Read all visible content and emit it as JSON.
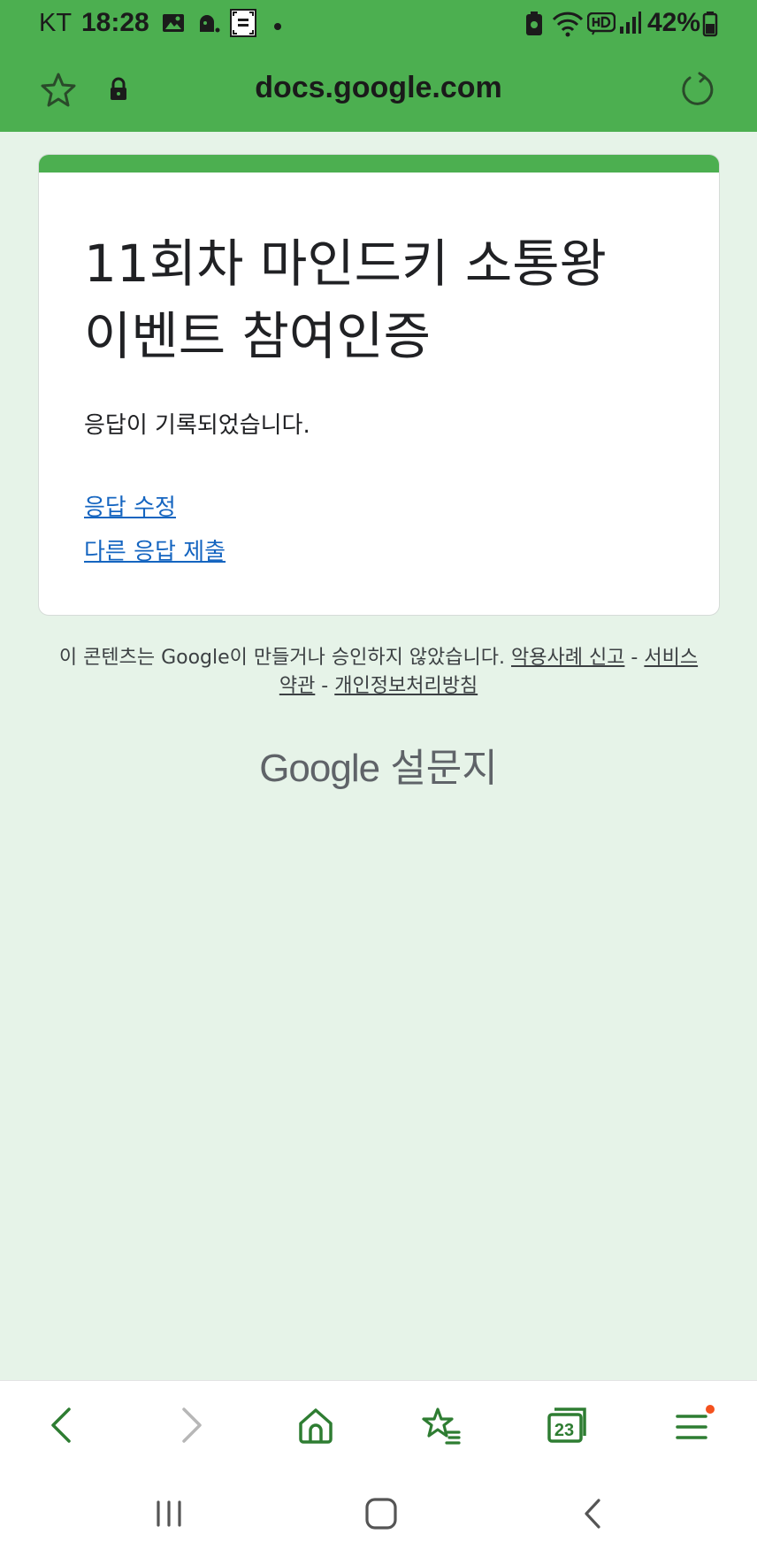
{
  "status_bar": {
    "carrier": "KT",
    "time": "18:28",
    "battery": "42%"
  },
  "browser": {
    "url": "docs.google.com",
    "tab_count": "23"
  },
  "form": {
    "title": "11회차 마인드키 소통왕 이벤트 참여인증",
    "confirmation": "응답이 기록되었습니다.",
    "edit_link": "응답 수정",
    "submit_another_link": "다른 응답 제출"
  },
  "footer": {
    "disclaimer": "이 콘텐츠는 Google이 만들거나 승인하지 않았습니다.",
    "report_link": "악용사례 신고",
    "separator": " - ",
    "terms_link": "서비스 약관",
    "privacy_link": "개인정보처리방침"
  },
  "brand": {
    "google": "Google",
    "product": "설문지"
  },
  "colors": {
    "toolbar": "#4caf50",
    "background": "#e6f3e8",
    "link": "#1565c0",
    "icon": "#2e7d32",
    "notification_dot": "#f4511e"
  }
}
